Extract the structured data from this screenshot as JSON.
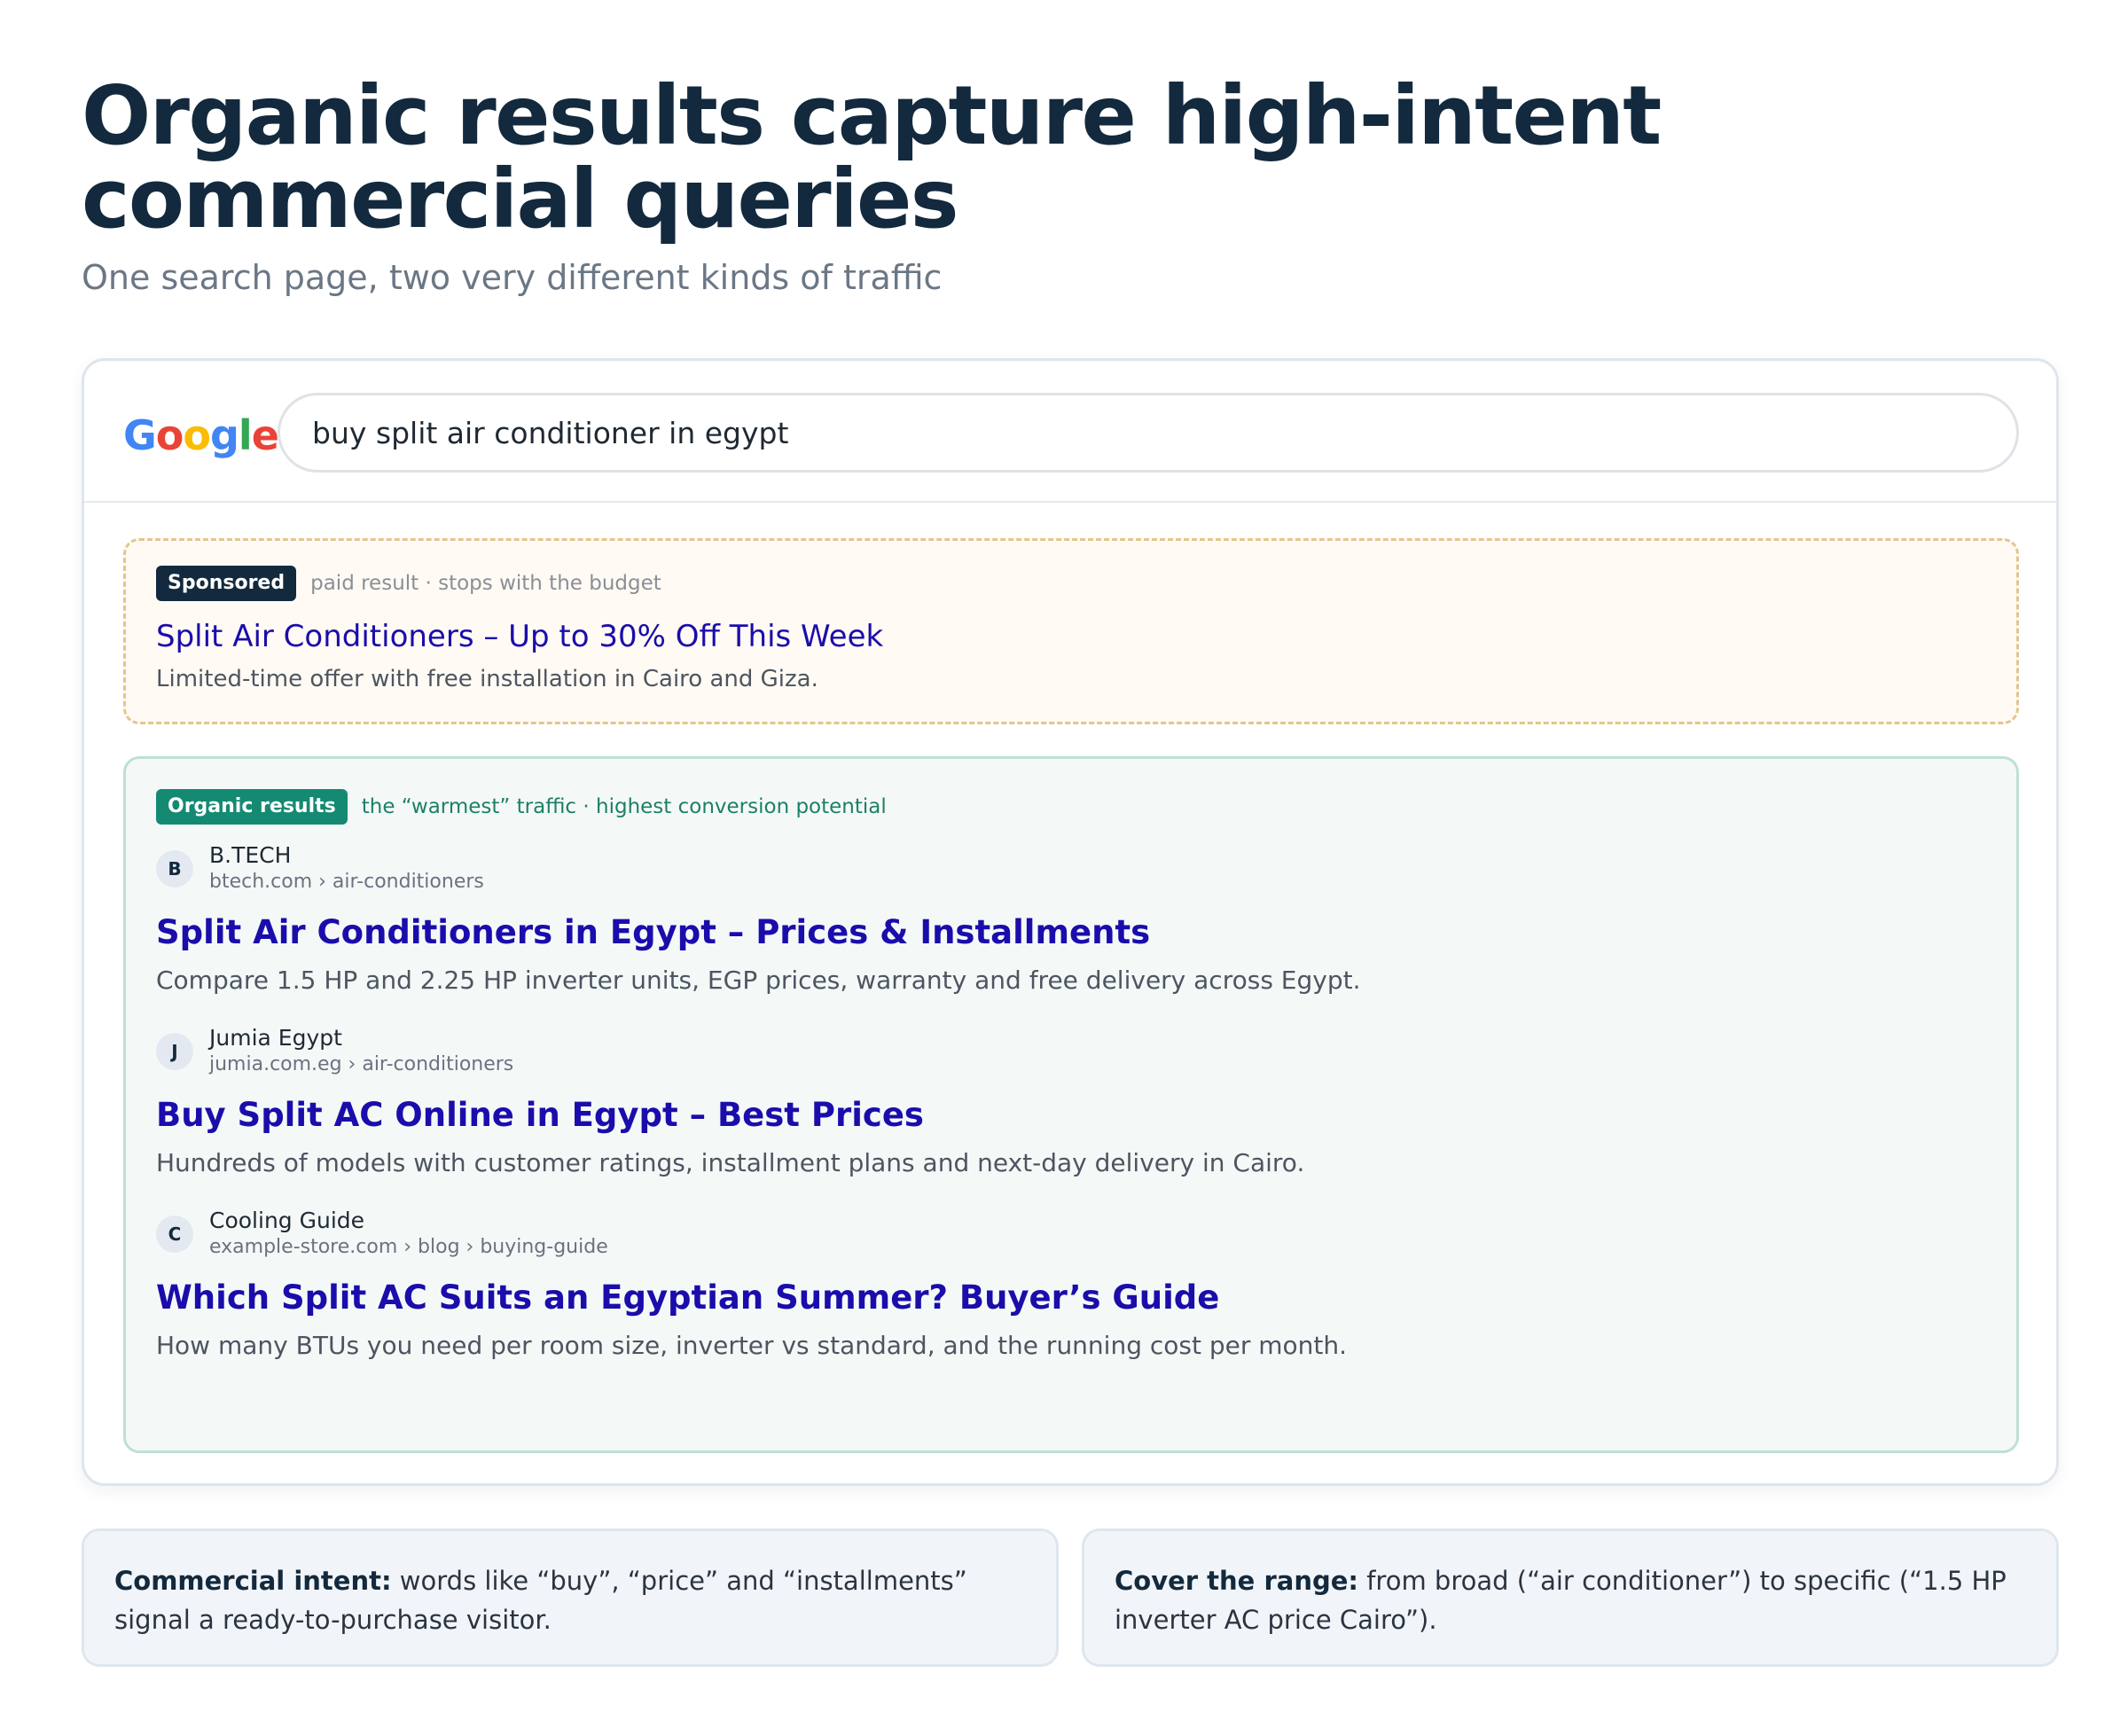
{
  "headline": "Organic results capture high-intent commercial queries",
  "subhead": "One search page, two very different kinds of traffic",
  "search": {
    "logo": [
      "G",
      "o",
      "o",
      "g",
      "l",
      "e"
    ],
    "query": "buy split air conditioner in egypt"
  },
  "sponsored": {
    "tag": "Sponsored",
    "note": "paid result · stops with the budget",
    "title": "Split Air Conditioners – Up to 30% Off This Week",
    "description": "Limited-time offer with free installation in Cairo and Giza."
  },
  "organic": {
    "tag": "Organic results",
    "note": "the “warmest” traffic · highest conversion potential",
    "results": [
      {
        "favicon": "B",
        "site": "B.TECH",
        "url": "btech.com › air-conditioners",
        "title": "Split Air Conditioners in Egypt – Prices & Installments",
        "description": "Compare 1.5 HP and 2.25 HP inverter units, EGP prices, warranty and free delivery across Egypt."
      },
      {
        "favicon": "J",
        "site": "Jumia Egypt",
        "url": "jumia.com.eg › air-conditioners",
        "title": "Buy Split AC Online in Egypt – Best Prices",
        "description": "Hundreds of models with customer ratings, installment plans and next-day delivery in Cairo."
      },
      {
        "favicon": "C",
        "site": "Cooling Guide",
        "url": "example-store.com › blog › buying-guide",
        "title": "Which Split AC Suits an Egyptian Summer? Buyer’s Guide",
        "description": "How many BTUs you need per room size, inverter vs standard, and the running cost per month."
      }
    ]
  },
  "callouts": [
    {
      "label": "Commercial intent:",
      "text": "words like “buy”, “price” and “installments” signal a ready-to-purchase visitor."
    },
    {
      "label": "Cover the range:",
      "text": "from broad (“air conditioner”) to specific (“1.5 HP inverter AC price Cairo”)."
    }
  ],
  "colors": {
    "navy": "#13293d",
    "link_blue": "#1a0dab",
    "organic_green": "#148a72",
    "sponsored_border": "#e3c68f"
  }
}
